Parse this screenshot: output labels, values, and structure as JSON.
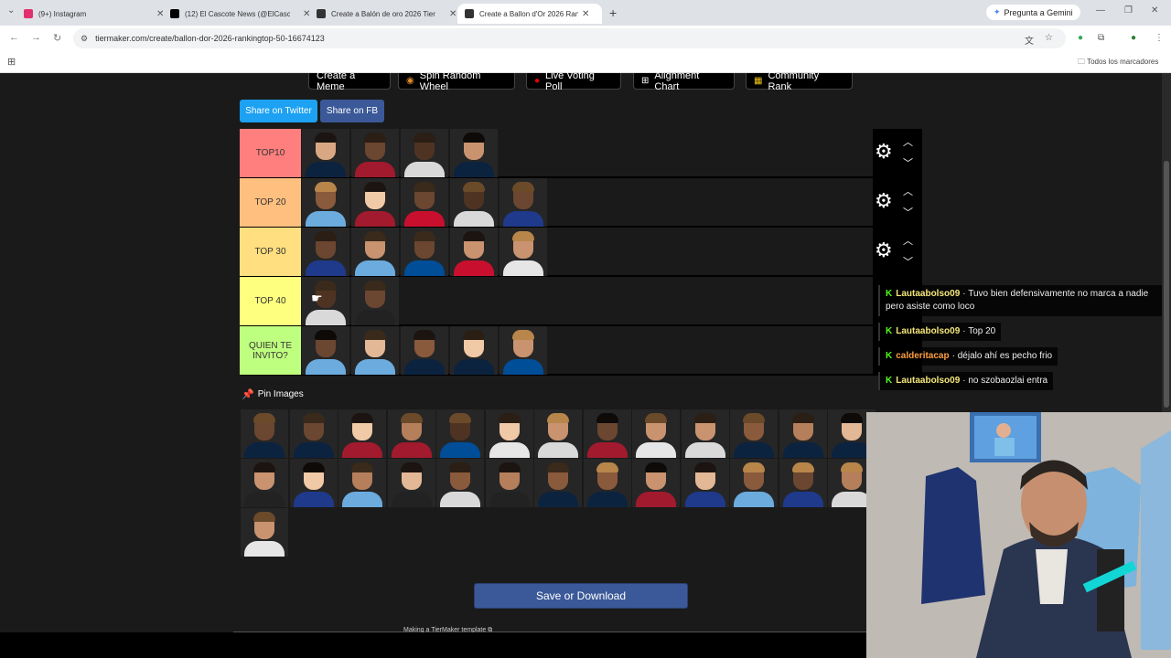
{
  "browser": {
    "tabs": [
      {
        "title": "(9+) Instagram",
        "favicon_color": "#e1306c"
      },
      {
        "title": "(12) El Cascote News (@ElCascote",
        "favicon_color": "#000000"
      },
      {
        "title": "Create a Balón de oro 2026 Tier",
        "favicon_color": "#333333"
      },
      {
        "title": "Create a Ballon d'Or 2026 Rank",
        "favicon_color": "#333333"
      }
    ],
    "gemini_label": "Pregunta a Gemini",
    "url": "tiermaker.com/create/ballon-dor-2026-rankingtop-50-16674123",
    "bookmarks_label": "Todos los marcadores"
  },
  "top_buttons": {
    "meme": "Create a Meme",
    "wheel": "Spin Random Wheel",
    "poll": "Live Voting Poll",
    "alignment": "Alignment Chart",
    "community": "Community Rank"
  },
  "share": {
    "twitter": "Share on Twitter",
    "fb": "Share on FB"
  },
  "tiers": [
    {
      "label": "TOP10",
      "color": "#ff7f7f",
      "count": 4
    },
    {
      "label": "TOP 20",
      "color": "#ffbf7f",
      "count": 5
    },
    {
      "label": "TOP 30",
      "color": "#ffdf7f",
      "count": 5
    },
    {
      "label": "TOP 40",
      "color": "#ffff7f",
      "count": 2
    },
    {
      "label": "QUIEN TE INVITO?",
      "color": "#bfff7f",
      "count": 5
    }
  ],
  "pin_images_label": "Pin Images",
  "pool_count": 27,
  "chat": [
    {
      "user": "Lautaabolso09",
      "user_color": "#f5e67a",
      "text": "Tuvo bien defensivamente no marca a nadie pero asiste como loco"
    },
    {
      "user": "Lautaabolso09",
      "user_color": "#f5e67a",
      "text": "Top 20"
    },
    {
      "user": "calderitacap",
      "user_color": "#ff9f40",
      "text": "déjalo ahí es pecho frio"
    },
    {
      "user": "Lautaabolso09",
      "user_color": "#f5e67a",
      "text": "no szobaozlai entra"
    }
  ],
  "chat_badge": "K",
  "save_button": "Save or Download",
  "footer_text": "Making a TierMaker template"
}
